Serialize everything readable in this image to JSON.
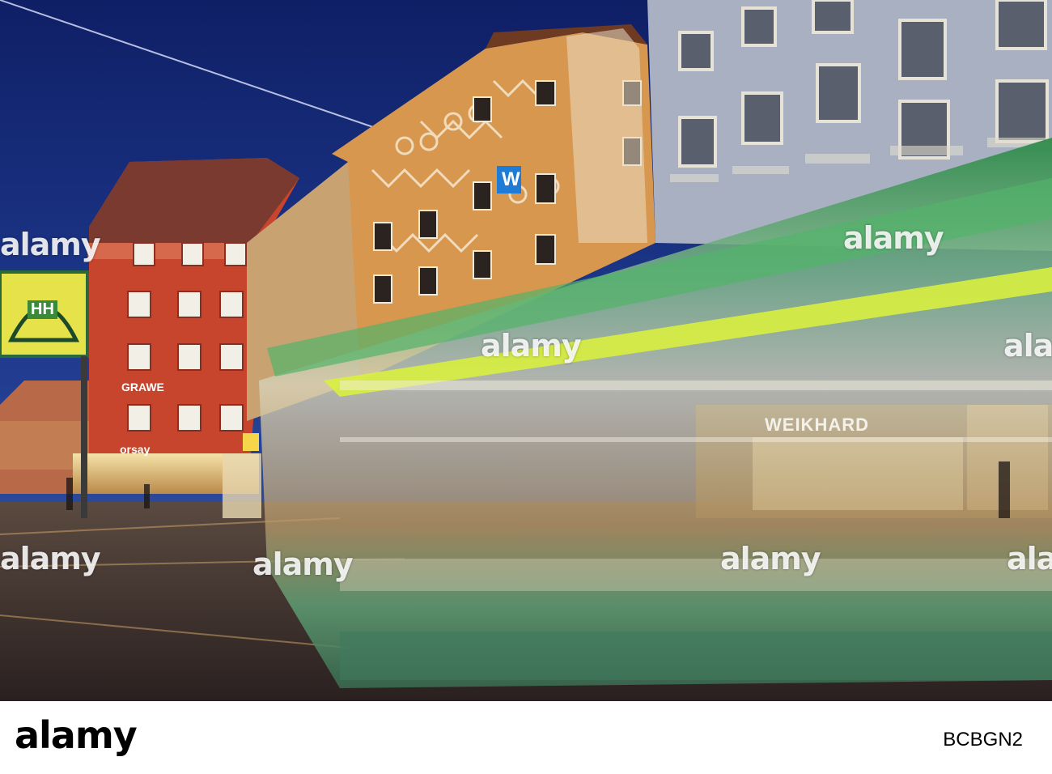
{
  "photo": {
    "signs": {
      "hh_stop": "HH",
      "tower_letter": "W",
      "grawe": "GRAWE",
      "orsay": "orsay",
      "weikhard": "WEIKHARD"
    },
    "watermark": "alamy"
  },
  "footer": {
    "logo": "alamy",
    "image_id": "BCBGN2"
  },
  "colors": {
    "sky": "#1b2f7a",
    "red_building": "#c8442a",
    "ochre_building": "#d79a4f",
    "tram_green": "#3a9a5a",
    "tram_lime": "#c8e23a"
  }
}
